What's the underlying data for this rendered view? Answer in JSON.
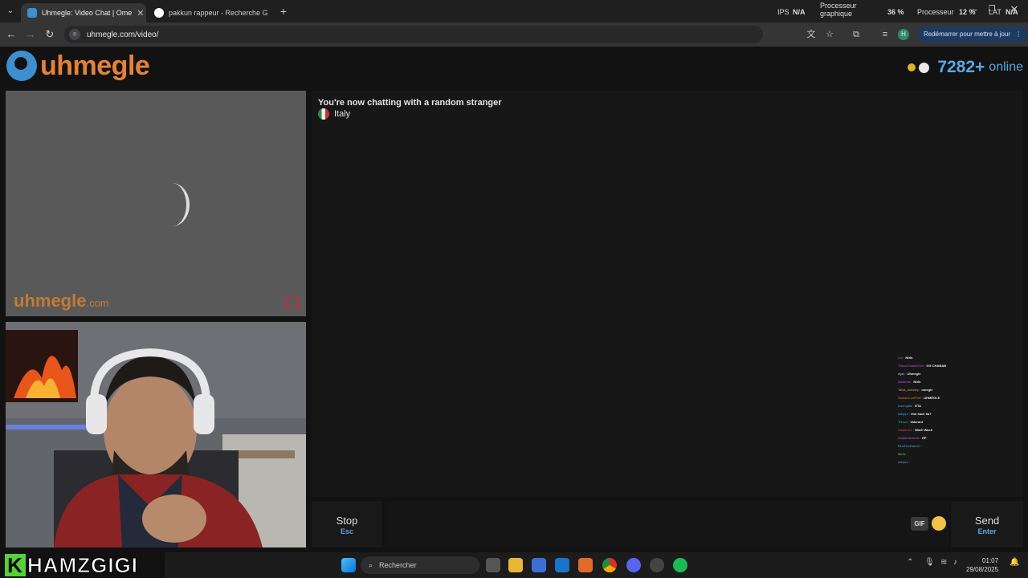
{
  "browser": {
    "tabs": [
      {
        "title": "Uhmegle: Video Chat | Ome",
        "active": true,
        "favicon_color": "#3d8fd0"
      },
      {
        "title": "pakkun rappeur - Recherche G",
        "active": false,
        "favicon_color": "#ffffff"
      }
    ],
    "new_tab": "+",
    "url": "uhmegle.com/video/",
    "restart_label": "Redémarrer pour mettre à jour",
    "profile_initial": "H",
    "hw_overlay": {
      "ips_label": "IPS",
      "ips_value": "N/A",
      "gpu_label_1": "Processeur",
      "gpu_label_2": "graphique",
      "gpu_value": "36 %",
      "cpu_label": "Processeur",
      "cpu_value": "12 %",
      "lat_label": "LAT",
      "lat_value": "N/A"
    }
  },
  "site": {
    "logo_text": "uhmegle",
    "online_count": "7282+",
    "online_label": "online",
    "watermark": "uhmegle",
    "watermark_suffix": ".com"
  },
  "chat": {
    "status": "You're now chatting with a random stranger",
    "country": "Italy",
    "stop_label": "Stop",
    "stop_shortcut": "Esc",
    "send_label": "Send",
    "send_shortcut": "Enter",
    "gif_label": "GIF",
    "input_value": ""
  },
  "stream_chat": [
    {
      "user": "xxx",
      "msg": "Ntrik",
      "color": "#c94bd8"
    },
    {
      "user": "ThiccoChonkGmn",
      "msg": "GG CHABAB",
      "color": "#c94bd8"
    },
    {
      "user": "eljaz",
      "msg": "Uhmegle",
      "color": "#a9d2ff"
    },
    {
      "user": "Adrienne",
      "msg": "Ntrik",
      "color": "#c94bd8"
    },
    {
      "user": "Tahla_dubstep",
      "msg": "omegle",
      "color": "#e0a040"
    },
    {
      "user": "SamanCoolPlan",
      "msg": "UHMEGLE",
      "color": "#e07030"
    },
    {
      "user": "Danmyltiz",
      "msg": "GTA",
      "color": "#4aa3e8"
    },
    {
      "user": "fullspm",
      "msg": "Vrai 3ach 6a?",
      "color": "#4aa3e8"
    },
    {
      "user": "Trinovi",
      "msg": "Valorant",
      "color": "#4aa3e8"
    },
    {
      "user": "Hashim11",
      "msg": "Wach Wach",
      "color": "#d84b4b"
    },
    {
      "user": "Wolfdodemode",
      "msg": "RP",
      "color": "#c94bd8"
    },
    {
      "user": "BlueFireDancer",
      "msg": "",
      "color": "#4aa3e8"
    },
    {
      "user": "Mk9x",
      "msg": "",
      "color": "#5ad040"
    },
    {
      "user": "fullspm",
      "msg": "",
      "color": "#4aa3e8"
    }
  ],
  "overlay": {
    "brand_k": "K",
    "brand_rest": "HAMZGIGI"
  },
  "taskbar": {
    "search_placeholder": "Rechercher",
    "time": "01:07",
    "date": "29/08/2025"
  }
}
